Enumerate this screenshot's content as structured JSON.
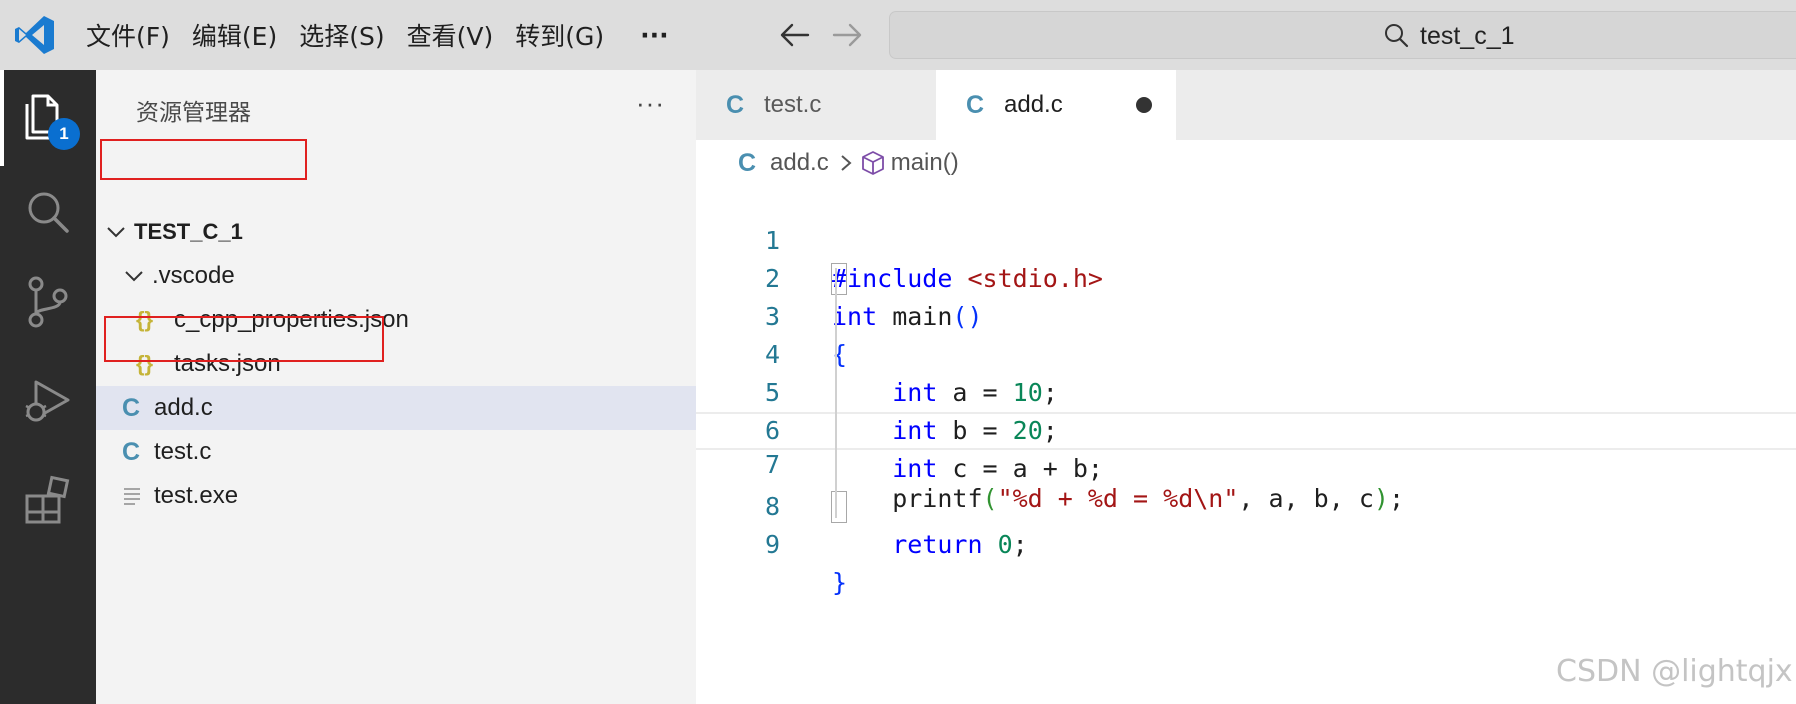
{
  "menu": {
    "items": [
      "文件(F)",
      "编辑(E)",
      "选择(S)",
      "查看(V)",
      "转到(G)"
    ],
    "more": "···"
  },
  "search": {
    "text": "test_c_1"
  },
  "activity": {
    "badge": "1"
  },
  "explorer": {
    "title": "资源管理器",
    "more": "···",
    "root": "TEST_C_1",
    "folder": ".vscode",
    "folder_files": [
      "c_cpp_properties.json",
      "tasks.json"
    ],
    "files": [
      "add.c",
      "test.c",
      "test.exe"
    ],
    "c_icon": "C",
    "json_icon": "{}"
  },
  "tabs": [
    {
      "label": "test.c",
      "active": false
    },
    {
      "label": "add.c",
      "active": true,
      "dirty": true
    }
  ],
  "breadcrumb": {
    "file": "add.c",
    "symbol": "main()"
  },
  "code": {
    "line_numbers": [
      "1",
      "2",
      "3",
      "4",
      "5",
      "6",
      "7",
      "8",
      "9"
    ],
    "lines": [
      "#include <stdio.h>",
      "int main()",
      "{",
      "    int a = 10;",
      "    int b = 20;",
      "    int c = a + b;",
      "    printf(\"%d + %d = %d\\n\", a, b, c);",
      "    return 0;",
      "}"
    ],
    "current_line": 7
  },
  "watermark": "CSDN @lightqjx",
  "colors": {
    "activity_bar": "#2c2c2c",
    "badge": "#0a6fd0",
    "highlight_box": "#e0201f",
    "keyword": "#0000ff",
    "string": "#a31515",
    "number": "#098658"
  }
}
